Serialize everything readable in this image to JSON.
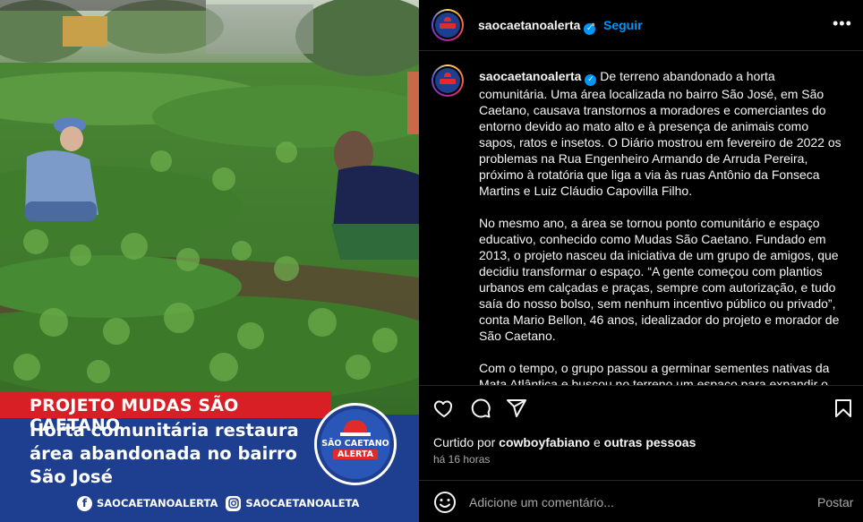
{
  "post_image": {
    "banner_title": "PROJETO MUDAS SÃO CAETANO",
    "headline_lines": [
      "Horta comunitária restaura",
      "área abandonada no bairro",
      "São José"
    ],
    "logo_text_top": "SÃO CAETANO",
    "logo_text_bottom": "ALERTA",
    "facebook_handle": "SAOCAETANOALERTA",
    "instagram_handle": "SAOCAETANOALETA",
    "brand_red": "#d81f26",
    "brand_blue": "#1e3f8f"
  },
  "header": {
    "username": "saocaetanoalerta",
    "verified_glyph": "✓",
    "separator": "•",
    "follow_label": "Seguir",
    "more_glyph": "•••"
  },
  "caption": {
    "username": "saocaetanoalerta",
    "paragraphs": [
      "De terreno abandonado a horta comunitária. Uma área localizada no bairro São José, em São Caetano, causava transtornos a moradores e comerciantes do entorno devido ao mato alto e à presença de animais como sapos, ratos e insetos. O Diário mostrou em fevereiro de 2022 os problemas na Rua Engenheiro Armando de Arruda Pereira, próximo à rotatória que liga a via às ruas Antônio da Fonseca Martins e Luiz Cláudio Capovilla Filho.",
      "No mesmo ano, a área se tornou ponto comunitário e espaço educativo, conhecido como Mudas São Caetano. Fundado em 2013, o projeto nasceu da iniciativa de um grupo de amigos, que decidiu transformar o espaço. “A gente começou com plantios urbanos em calçadas e praças, sempre com autorização, e tudo saía do nosso bolso, sem nenhum incentivo público ou privado”, conta Mario Bellon, 46 anos, idealizador do projeto e morador de São Caetano.",
      "Com o tempo, o grupo passou a germinar sementes nativas da Mata Atlântica e buscou no terreno um espaço para expandir o"
    ]
  },
  "actions": {
    "icons": [
      "heart-icon",
      "comment-icon",
      "share-icon",
      "bookmark-icon"
    ]
  },
  "likes": {
    "prefix": "Curtido por",
    "user": "cowboyfabiano",
    "connector": "e",
    "others": "outras pessoas"
  },
  "timestamp": "há 16 horas",
  "comment": {
    "placeholder": "Adicione um comentário...",
    "post_label": "Postar"
  },
  "colors": {
    "background": "#000000",
    "link_blue": "#0095f6",
    "muted_text": "#a8a8a8",
    "divider": "#262626"
  }
}
